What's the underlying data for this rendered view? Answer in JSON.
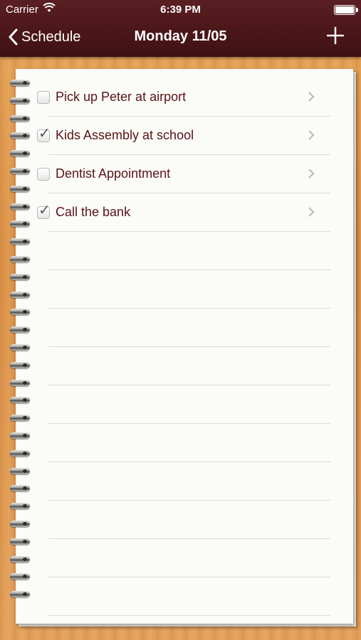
{
  "status_bar": {
    "carrier": "Carrier",
    "time": "6:39 PM"
  },
  "navbar": {
    "back_label": "Schedule",
    "title": "Monday 11/05",
    "add_icon": "plus-icon"
  },
  "tasks": [
    {
      "label": "Pick up Peter at airport",
      "checked": false
    },
    {
      "label": "Kids Assembly at school",
      "checked": true
    },
    {
      "label": "Dentist Appointment",
      "checked": false
    },
    {
      "label": "Call the bank",
      "checked": true
    }
  ],
  "colors": {
    "navbar": "#4a1619",
    "task_text": "#5a1418",
    "wood": "#dc9248"
  }
}
